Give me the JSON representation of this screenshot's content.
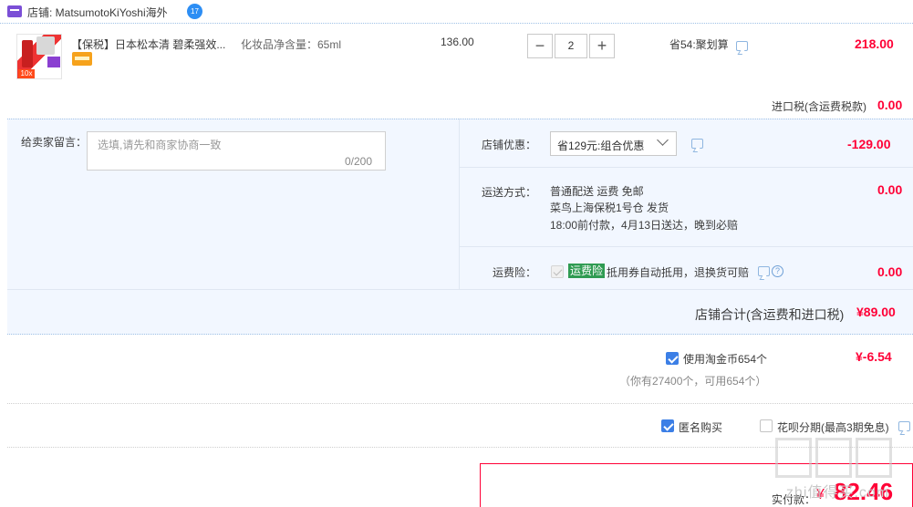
{
  "shop": {
    "label": "店铺: MatsumotoKiYoshi海外",
    "wangwang_badge": "17"
  },
  "item": {
    "title": "【保税】日本松本清 碧柔强效...",
    "spec": "化妆品净含量：65ml",
    "unit_price": "136.00",
    "quantity": "2",
    "qty_minus": "−",
    "qty_plus": "+",
    "promo": "省54:聚划算",
    "line_total": "218.00",
    "thumb_tag": "10x"
  },
  "import_tax": {
    "label": "进口税(含运费税款)",
    "value": "0.00"
  },
  "message": {
    "label": "给卖家留言：",
    "placeholder": "选填,请先和商家协商一致",
    "count": "0/200"
  },
  "shop_discount": {
    "label": "店铺优惠：",
    "selected": "省129元:组合优惠",
    "value": "-129.00"
  },
  "shipping": {
    "label": "运送方式：",
    "line1": "普通配送 运费 免邮",
    "line2": "菜鸟上海保税1号仓  发货",
    "line3": "18:00前付款，4月13日送达，晚到必赔",
    "value": "0.00"
  },
  "freight_insurance": {
    "label": "运费险：",
    "tag": "运费险",
    "desc": "抵用券自动抵用，退换货可赔",
    "value": "0.00",
    "help": "?"
  },
  "shop_total": {
    "label": "店铺合计(含运费和进口税)",
    "value": "¥89.00"
  },
  "coins": {
    "label": "使用淘金币654个",
    "value": "¥-6.54",
    "sub": "（你有27400个，可用654个）",
    "checked": true
  },
  "options": {
    "anonymous": "匿名购买",
    "huabei": "花呗分期(最高3期免息)"
  },
  "payment": {
    "label": "实付款：",
    "currency": "¥",
    "amount": "82.46"
  },
  "watermark": {
    "text": "zhi值得买.com"
  },
  "colors": {
    "accent_red": "#ff0036",
    "panel_blue": "#f2f7ff",
    "checkbox_blue": "#3c7fe6",
    "insurance_green": "#2f9b52"
  }
}
